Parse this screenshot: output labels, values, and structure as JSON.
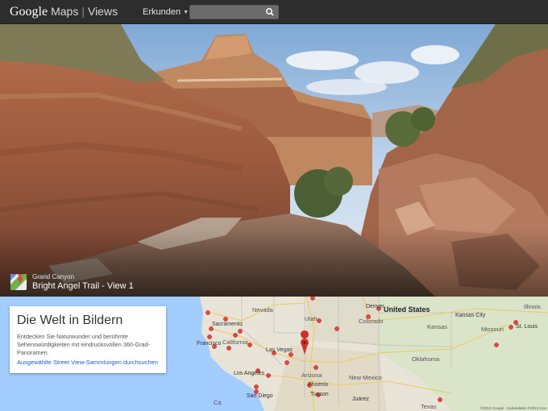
{
  "topbar": {
    "logo_google": "Google",
    "logo_maps": "Maps",
    "logo_separator": "|",
    "logo_views": "Views",
    "explore_label": "Erkunden",
    "search_value": "",
    "search_icon": "search-icon"
  },
  "hero": {
    "place_name": "Grand Canyon",
    "view_title": "Bright Angel Trail - View 1",
    "pin_icon": "maps-pin-icon",
    "sky_color": "#b9d3ea",
    "rock_color": "#9c5a3e"
  },
  "card": {
    "heading": "Die Welt in Bildern",
    "description": "Entdecken Sie Naturwunder und berühmte Sehenswürdigkeiten mit eindrucksvollen 360-Grad-Panoramen.",
    "link_label": "Ausgewählte Street View-Sammlungen durchsuchen",
    "link_color": "#1a5ccf"
  },
  "map": {
    "labels": {
      "united_states": "United States",
      "nevada": "Nevada",
      "utah": "Utah",
      "colorado": "Colorado",
      "denver": "Denver",
      "kansas": "Kansas",
      "kansas_city": "Kansas City",
      "missouri": "Missouri",
      "st_louis": "St. Louis",
      "illinois": "Illinois",
      "sacramento": "Sacramento",
      "san_francisco": "Francisco",
      "california": "California",
      "las_vegas": "Las Vegas",
      "arizona": "Arizona",
      "new_mexico": "New Mexico",
      "oklahoma": "Oklahoma",
      "los_angeles": "Los Angeles",
      "san_diego": "San Diego",
      "phoenix": "Phoenix",
      "tucson": "Tucson",
      "juarez": "Juárez",
      "texas": "Texas",
      "ca": "Ca"
    },
    "attribution": "©2013 Google · Kartendaten ©2013 Goo",
    "marker_color": "#e8453c",
    "selected_marker_color": "#d0312a"
  }
}
